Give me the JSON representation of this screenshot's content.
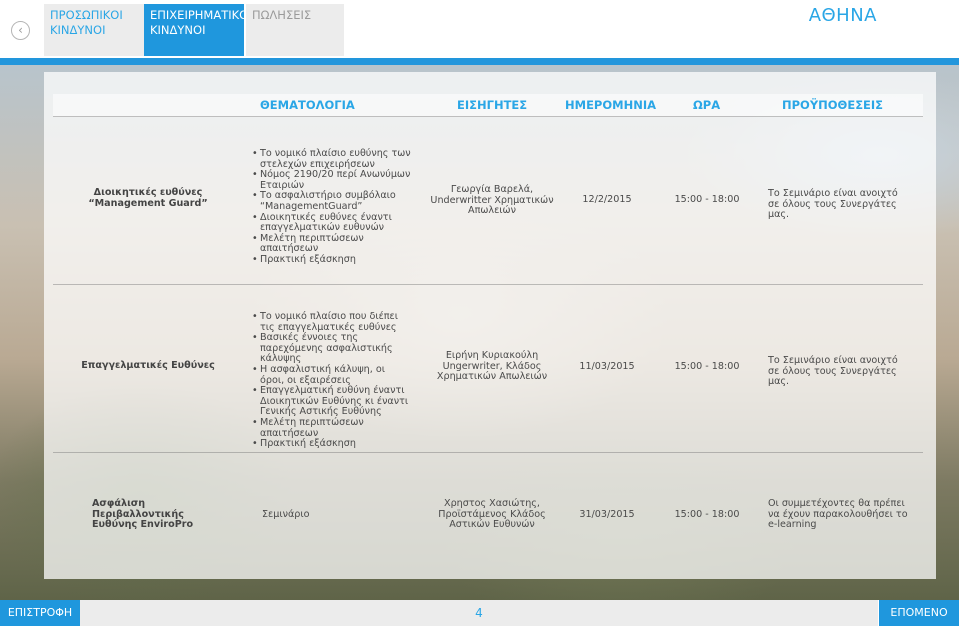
{
  "header": {
    "tabs": [
      {
        "label": "ΠΡΟΣΩΠΙΚΟΙ ΚΙΝΔΥΝΟΙ"
      },
      {
        "label": "ΕΠΙΧΕΙΡΗΜΑΤΙΚΟΙ ΚΙΝΔΥΝΟΙ"
      },
      {
        "label": "ΠΩΛΗΣΕΙΣ"
      }
    ],
    "city": "ΑΘΗΝΑ",
    "back_icon": "‹"
  },
  "table": {
    "columns": [
      "ΘΕΜΑΤΟΛΟΓΙΑ",
      "ΕΙΣΗΓΗΤΕΣ",
      "ΗΜΕΡΟΜΗΝΙΑ",
      "ΩΡΑ",
      "ΠΡΟΫΠΟΘΕΣΕΙΣ"
    ],
    "rows": [
      {
        "topic_line1": "Διοικητικές ευθύνες",
        "topic_line2": "“Management Guard”",
        "bullets": [
          "Το νομικό πλαίσιο ευθύνης των στελεχών επιχειρήσεων",
          "Νόμος 2190/20 περί Ανωνύμων Εταιριών",
          "Το ασφαλιστήριο συμβόλαιο “ManagementGuard”",
          "Διοικητικές ευθύνες έναντι επαγγελματικών ευθυνών",
          "Μελέτη περιπτώσεων απαιτήσεων",
          "Πρακτική εξάσκηση"
        ],
        "speaker": "Γεωργία Βαρελά, Underwritter Χρηματικών Απωλειών",
        "date": "12/2/2015",
        "time": "15:00 - 18:00",
        "prereq": "Το Σεμινάριο είναι ανοιχτό σε όλους τους Συνεργάτες μας."
      },
      {
        "topic_line1": "Επαγγελματικές Ευθύνες",
        "bullets": [
          "Το νομικό πλαίσιο που διέπει τις επαγγελματικές ευθύνες",
          "Βασικές έννοιες της παρεχόμενης ασφαλιστικής κάλυψης",
          "Η ασφαλιστική κάλυψη, οι όροι, οι εξαιρέσεις",
          "Επαγγελματική ευθύνη έναντι Διοικητικών Ευθύνης κι έναντι Γενικής Αστικής Ευθύνης",
          "Μελέτη περιπτώσεων απαιτήσεων",
          "Πρακτική εξάσκηση"
        ],
        "speaker": "Ειρήνη Κυριακούλη Ungerwriter, Κλάδος Χρηματικών Απωλειών",
        "date": "11/03/2015",
        "time": "15:00 - 18:00",
        "prereq": "Το Σεμινάριο είναι ανοιχτό σε όλους τους Συνεργάτες μας."
      },
      {
        "topic_line1": "Ασφάλιση Περιβαλλοντικής Ευθύνης EnviroPro",
        "plain": "Σεμινάριο",
        "speaker": "Χρηστος Χασιώτης, Προϊστάμενος Κλάδος Αστικών Ευθυνών",
        "date": "31/03/2015",
        "time": "15:00 - 18:00",
        "prereq": "Οι συμμετέχοντες θα πρέπει να έχουν παρακολουθήσει το e-learning"
      }
    ]
  },
  "footer": {
    "back_label": "ΕΠΙΣΤΡΟΦΗ",
    "page": "4",
    "next_label": "ΕΠΟΜΕΝΟ"
  }
}
